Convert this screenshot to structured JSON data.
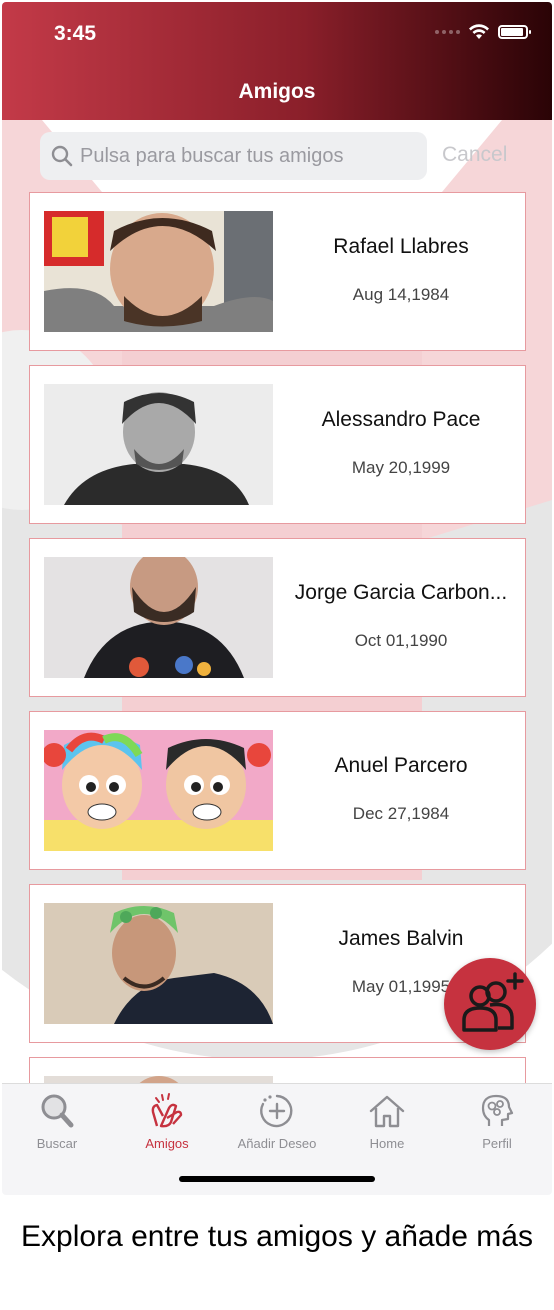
{
  "status_bar": {
    "time": "3:45"
  },
  "nav": {
    "title": "Amigos"
  },
  "search": {
    "placeholder": "Pulsa para buscar tus amigos",
    "value": "",
    "cancel_label": "Cancel"
  },
  "friends": [
    {
      "name": "Rafael Llabres",
      "date": "Aug 14,1984"
    },
    {
      "name": "Alessandro Pace",
      "date": "May 20,1999"
    },
    {
      "name": "Jorge Garcia Carbon...",
      "date": "Oct 01,1990"
    },
    {
      "name": "Anuel Parcero",
      "date": "Dec 27,1984"
    },
    {
      "name": "James Balvin",
      "date": "May 01,1995"
    },
    {
      "name": "",
      "date": ""
    }
  ],
  "tabs": [
    {
      "label": "Buscar",
      "icon": "magnifier-icon",
      "active": false
    },
    {
      "label": "Amigos",
      "icon": "clapping-hands-icon",
      "active": true
    },
    {
      "label": "Añadir Deseo",
      "icon": "add-circle-icon",
      "active": false
    },
    {
      "label": "Home",
      "icon": "house-icon",
      "active": false
    },
    {
      "label": "Perfil",
      "icon": "head-gears-icon",
      "active": false
    }
  ],
  "fab": {
    "icon": "add-friend-icon"
  },
  "caption": "Explora entre tus amigos y añade más",
  "colors": {
    "accent": "#c6323f",
    "card_border": "#e79a9f",
    "header_start": "#c33a48",
    "header_end": "#2a0306"
  }
}
